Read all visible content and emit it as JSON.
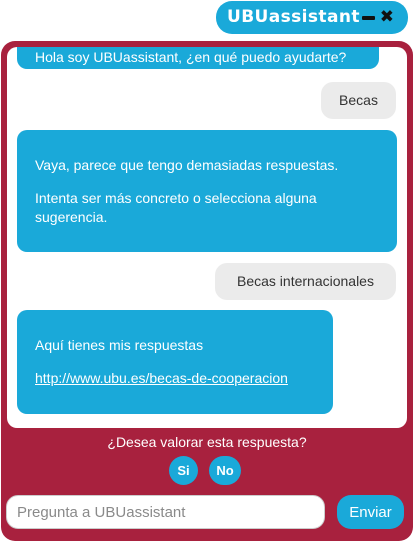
{
  "header": {
    "title": "UBUassistant",
    "minimize_icon": "minus-icon",
    "close_icon": "close-icon",
    "close_glyph": "✖"
  },
  "colors": {
    "accent": "#1aa9d9",
    "window": "#a8213e",
    "user_bubble": "#ebebeb"
  },
  "messages": {
    "greeting": "Hola soy UBUassistant, ¿en qué puedo ayudarte?",
    "user_1": "Becas",
    "bot_too_many_line1": "Vaya, parece que tengo demasiadas respuestas.",
    "bot_too_many_line2": "Intenta ser más concreto o selecciona alguna sugerencia.",
    "user_2": "Becas internacionales",
    "bot_answer_text": "Aquí tienes mis respuestas",
    "bot_answer_link": "http://www.ubu.es/becas-de-cooperacion"
  },
  "rating": {
    "question": "¿Desea valorar esta respuesta?",
    "yes_label": "Si",
    "no_label": "No"
  },
  "input": {
    "placeholder": "Pregunta a UBUassistant",
    "value": "",
    "send_label": "Enviar"
  }
}
